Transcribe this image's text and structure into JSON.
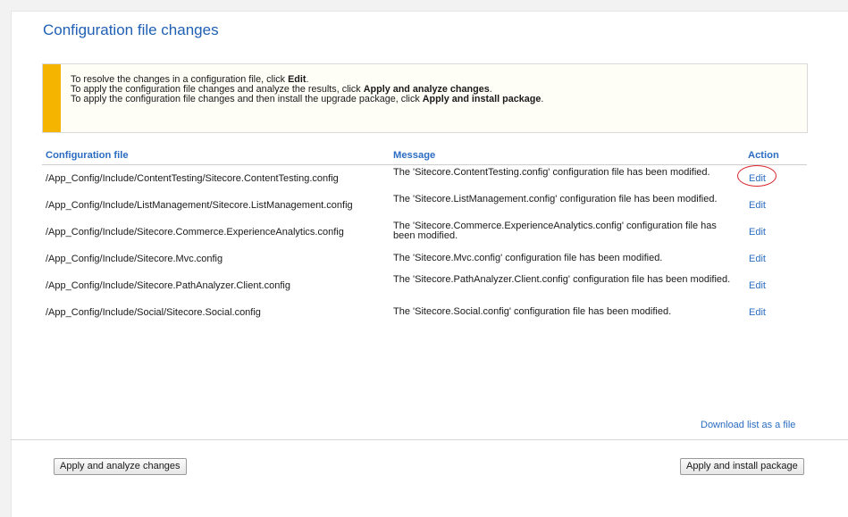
{
  "page": {
    "title": "Configuration file changes"
  },
  "info": {
    "line1_pre": "To resolve the changes in a configuration file, click ",
    "line1_bold": "Edit",
    "line1_post": ".",
    "line2_pre": "To apply the configuration file changes and analyze the results, click ",
    "line2_bold": "Apply and analyze changes",
    "line2_post": ".",
    "line3_pre": "To apply the configuration file changes and then install the upgrade package, click ",
    "line3_bold": "Apply and install package",
    "line3_post": "."
  },
  "grid": {
    "headers": {
      "file": "Configuration file",
      "message": "Message",
      "action": "Action"
    },
    "rows": [
      {
        "file": "/App_Config/Include/ContentTesting/Sitecore.ContentTesting.config",
        "message": "The 'Sitecore.ContentTesting.config' configuration file has been modified.",
        "action": "Edit"
      },
      {
        "file": "/App_Config/Include/ListManagement/Sitecore.ListManagement.config",
        "message": "The 'Sitecore.ListManagement.config' configuration file has been modified.",
        "action": "Edit"
      },
      {
        "file": "/App_Config/Include/Sitecore.Commerce.ExperienceAnalytics.config",
        "message": "The 'Sitecore.Commerce.ExperienceAnalytics.config' configuration file has been modified.",
        "action": "Edit"
      },
      {
        "file": "/App_Config/Include/Sitecore.Mvc.config",
        "message": "The 'Sitecore.Mvc.config' configuration file has been modified.",
        "action": "Edit"
      },
      {
        "file": "/App_Config/Include/Sitecore.PathAnalyzer.Client.config",
        "message": "The 'Sitecore.PathAnalyzer.Client.config' configuration file has been modified.",
        "action": "Edit"
      },
      {
        "file": "/App_Config/Include/Social/Sitecore.Social.config",
        "message": "The 'Sitecore.Social.config' configuration file has been modified.",
        "action": "Edit"
      }
    ]
  },
  "footer": {
    "download_link": "Download list as a file",
    "analyze_button": "Apply and analyze changes",
    "install_button": "Apply and install package"
  },
  "colors": {
    "title": "#1f5fb4",
    "link": "#2a6cc2",
    "warning_bar": "#f5b400",
    "highlight_circle": "#d9252b"
  }
}
